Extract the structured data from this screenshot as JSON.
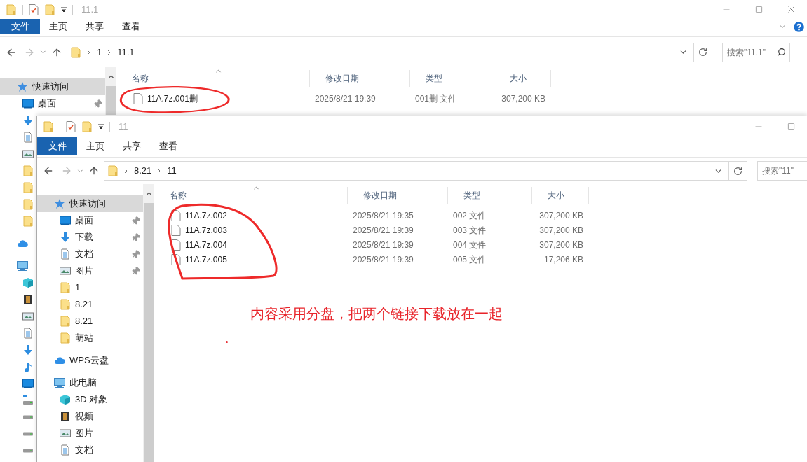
{
  "back_window": {
    "title": "11.1",
    "ribbon_tabs": [
      {
        "label": "文件",
        "kind": "file"
      },
      {
        "label": "主页",
        "kind": "tab"
      },
      {
        "label": "共享",
        "kind": "tab"
      },
      {
        "label": "查看",
        "kind": "tab"
      }
    ],
    "breadcrumb": [
      "1",
      "11.1"
    ],
    "search": {
      "placeholder": "搜索\"11.1\""
    },
    "sidebar": {
      "items": [
        {
          "label": "快速访问",
          "kind": "star",
          "selected": true,
          "children": [
            {
              "label": "桌面",
              "kind": "desktop",
              "selected": false,
              "pinned": true
            },
            {
              "kind": "download",
              "selected": false
            },
            {
              "kind": "document",
              "selected": false
            },
            {
              "kind": "picture",
              "selected": false
            },
            {
              "kind": "folder",
              "selected": false
            },
            {
              "kind": "folder",
              "selected": false
            },
            {
              "kind": "folder",
              "selected": false
            },
            {
              "kind": "folder",
              "selected": false
            }
          ]
        },
        {
          "kind": "cloud",
          "selected": false
        },
        {
          "kind": "pc",
          "selected": false,
          "children": [
            {
              "kind": "cube",
              "selected": false
            },
            {
              "kind": "video",
              "selected": false
            },
            {
              "kind": "picture",
              "selected": false
            },
            {
              "kind": "document",
              "selected": false
            },
            {
              "kind": "download",
              "selected": false
            },
            {
              "kind": "music",
              "selected": false
            },
            {
              "kind": "desktop",
              "selected": false
            },
            {
              "kind": "windrive",
              "selected": false
            },
            {
              "kind": "drive",
              "selected": false
            },
            {
              "kind": "drive",
              "selected": false
            },
            {
              "kind": "drive",
              "selected": false
            }
          ]
        }
      ]
    },
    "columns": [
      "名称",
      "修改日期",
      "类型",
      "大小"
    ],
    "rows": [
      [
        "11A.7z.001删",
        "2025/8/21 19:39",
        "001删 文件",
        "307,200 KB"
      ]
    ]
  },
  "front_window": {
    "title": "11",
    "ribbon_tabs": [
      {
        "label": "文件",
        "kind": "file"
      },
      {
        "label": "主页",
        "kind": "tab"
      },
      {
        "label": "共享",
        "kind": "tab"
      },
      {
        "label": "查看",
        "kind": "tab"
      }
    ],
    "breadcrumb": [
      "8.21",
      "11"
    ],
    "search": {
      "placeholder": "搜索\"11\""
    },
    "sidebar": {
      "items": [
        {
          "label": "快速访问",
          "kind": "star",
          "selected": true,
          "children": [
            {
              "label": "桌面",
              "kind": "desktop",
              "selected": false,
              "pinned": true
            },
            {
              "label": "下载",
              "kind": "download",
              "selected": false,
              "pinned": true
            },
            {
              "label": "文档",
              "kind": "document",
              "selected": false,
              "pinned": true
            },
            {
              "label": "图片",
              "kind": "picture",
              "selected": false,
              "pinned": true
            },
            {
              "label": "1",
              "kind": "folder",
              "selected": false,
              "pinned": false
            },
            {
              "label": "8.21",
              "kind": "folder",
              "selected": false,
              "pinned": false
            },
            {
              "label": "8.21",
              "kind": "folder",
              "selected": false,
              "pinned": false
            },
            {
              "label": "萌站",
              "kind": "folder",
              "selected": false,
              "pinned": false
            }
          ]
        },
        {
          "label": "WPS云盘",
          "kind": "cloud",
          "selected": false
        },
        {
          "label": "此电脑",
          "kind": "pc",
          "selected": false,
          "children": [
            {
              "label": "3D 对象",
              "kind": "cube",
              "selected": false
            },
            {
              "label": "视频",
              "kind": "video",
              "selected": false
            },
            {
              "label": "图片",
              "kind": "picture",
              "selected": false
            },
            {
              "label": "文档",
              "kind": "document",
              "selected": false
            }
          ]
        }
      ]
    },
    "columns": [
      "名称",
      "修改日期",
      "类型",
      "大小"
    ],
    "rows": [
      [
        "11A.7z.002",
        "2025/8/21 19:35",
        "002 文件",
        "307,200 KB"
      ],
      [
        "11A.7z.003",
        "2025/8/21 19:39",
        "003 文件",
        "307,200 KB"
      ],
      [
        "11A.7z.004",
        "2025/8/21 19:39",
        "004 文件",
        "307,200 KB"
      ],
      [
        "11A.7z.005",
        "2025/8/21 19:39",
        "005 文件",
        "17,206 KB"
      ]
    ]
  },
  "annotation": {
    "note": "内容采用分盘，把两个链接下载放在一起"
  }
}
